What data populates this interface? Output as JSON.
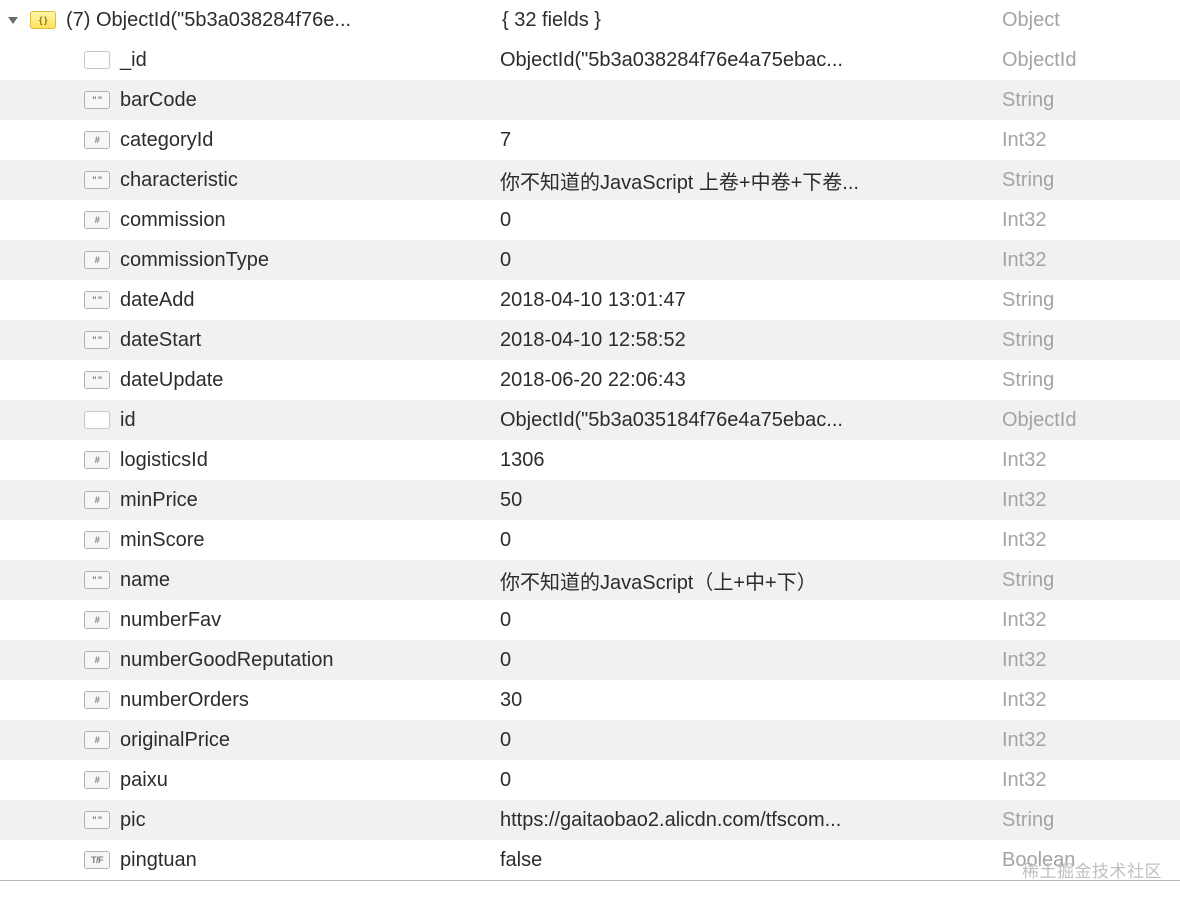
{
  "root": {
    "expanded": true,
    "icon": "object",
    "iconLabel": "{ }",
    "label": "(7) ObjectId(\"5b3a038284f76e...",
    "value": "{ 32 fields }",
    "type": "Object"
  },
  "fields": [
    {
      "iconType": "doc",
      "iconLabel": "",
      "key": "_id",
      "value": "ObjectId(\"5b3a038284f76e4a75ebac...",
      "type": "ObjectId"
    },
    {
      "iconType": "string",
      "iconLabel": "\" \"",
      "key": "barCode",
      "value": "",
      "type": "String"
    },
    {
      "iconType": "int",
      "iconLabel": "#",
      "key": "categoryId",
      "value": "7",
      "type": "Int32"
    },
    {
      "iconType": "string",
      "iconLabel": "\" \"",
      "key": "characteristic",
      "value": "你不知道的JavaScript 上卷+中卷+下卷...",
      "type": "String"
    },
    {
      "iconType": "int",
      "iconLabel": "#",
      "key": "commission",
      "value": "0",
      "type": "Int32"
    },
    {
      "iconType": "int",
      "iconLabel": "#",
      "key": "commissionType",
      "value": "0",
      "type": "Int32"
    },
    {
      "iconType": "string",
      "iconLabel": "\" \"",
      "key": "dateAdd",
      "value": "2018-04-10 13:01:47",
      "type": "String"
    },
    {
      "iconType": "string",
      "iconLabel": "\" \"",
      "key": "dateStart",
      "value": "2018-04-10 12:58:52",
      "type": "String"
    },
    {
      "iconType": "string",
      "iconLabel": "\" \"",
      "key": "dateUpdate",
      "value": "2018-06-20 22:06:43",
      "type": "String"
    },
    {
      "iconType": "doc",
      "iconLabel": "",
      "key": "id",
      "value": "ObjectId(\"5b3a035184f76e4a75ebac...",
      "type": "ObjectId"
    },
    {
      "iconType": "int",
      "iconLabel": "#",
      "key": "logisticsId",
      "value": "1306",
      "type": "Int32"
    },
    {
      "iconType": "int",
      "iconLabel": "#",
      "key": "minPrice",
      "value": "50",
      "type": "Int32"
    },
    {
      "iconType": "int",
      "iconLabel": "#",
      "key": "minScore",
      "value": "0",
      "type": "Int32"
    },
    {
      "iconType": "string",
      "iconLabel": "\" \"",
      "key": "name",
      "value": "你不知道的JavaScript（上+中+下）",
      "type": "String"
    },
    {
      "iconType": "int",
      "iconLabel": "#",
      "key": "numberFav",
      "value": "0",
      "type": "Int32"
    },
    {
      "iconType": "int",
      "iconLabel": "#",
      "key": "numberGoodReputation",
      "value": "0",
      "type": "Int32"
    },
    {
      "iconType": "int",
      "iconLabel": "#",
      "key": "numberOrders",
      "value": "30",
      "type": "Int32"
    },
    {
      "iconType": "int",
      "iconLabel": "#",
      "key": "originalPrice",
      "value": "0",
      "type": "Int32"
    },
    {
      "iconType": "int",
      "iconLabel": "#",
      "key": "paixu",
      "value": "0",
      "type": "Int32"
    },
    {
      "iconType": "string",
      "iconLabel": "\" \"",
      "key": "pic",
      "value": "https://gaitaobao2.alicdn.com/tfscom...",
      "type": "String"
    },
    {
      "iconType": "bool",
      "iconLabel": "T/F",
      "key": "pingtuan",
      "value": "false",
      "type": "Boolean"
    }
  ],
  "watermark": "稀土掘金技术社区"
}
